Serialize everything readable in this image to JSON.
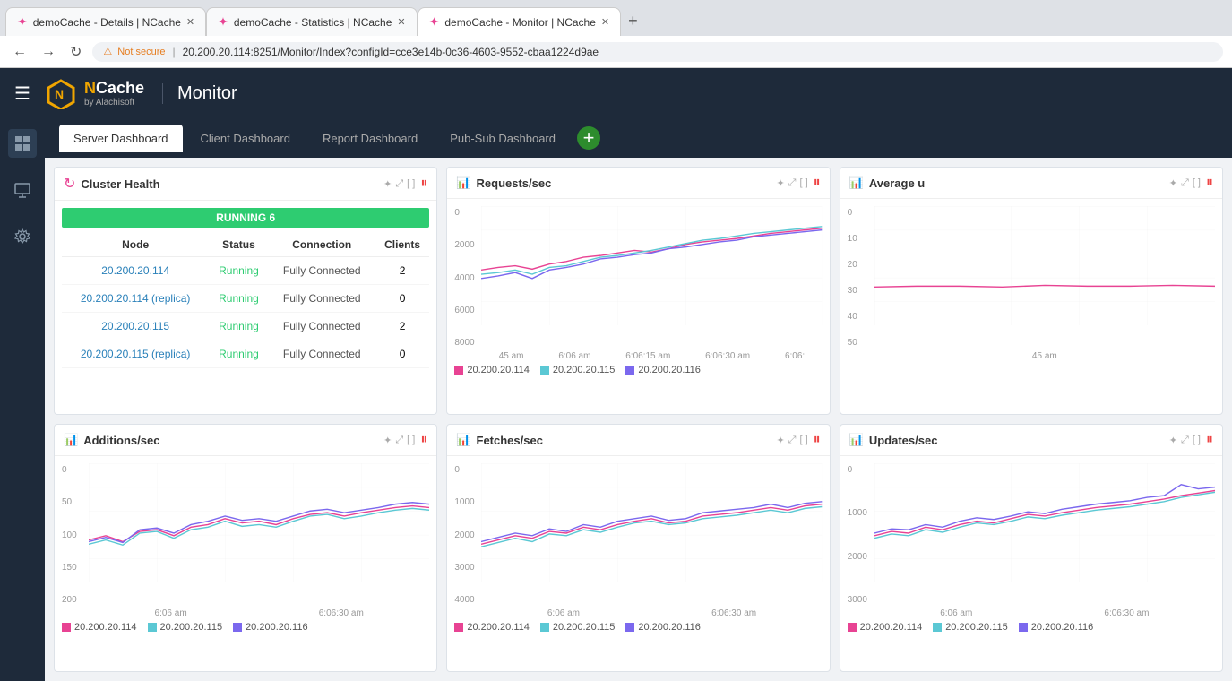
{
  "browser": {
    "tabs": [
      {
        "label": "demoCache - Details | NCache",
        "active": false
      },
      {
        "label": "demoCache - Statistics | NCache",
        "active": false
      },
      {
        "label": "demoCache - Monitor | NCache",
        "active": true
      }
    ],
    "address": "20.200.20.114:8251/Monitor/Index?configId=cce3e14b-0c36-4603-9552-cbaa1224d9ae",
    "security_warning": "Not secure"
  },
  "header": {
    "app_title": "Monitor",
    "logo": "NCache",
    "logo_sub": "by Alachisoft"
  },
  "nav_tabs": [
    {
      "label": "Server Dashboard",
      "active": true
    },
    {
      "label": "Client Dashboard",
      "active": false
    },
    {
      "label": "Report Dashboard",
      "active": false
    },
    {
      "label": "Pub-Sub Dashboard",
      "active": false
    }
  ],
  "cluster_health": {
    "title": "Cluster Health",
    "status": "RUNNING 6",
    "columns": [
      "Node",
      "Status",
      "Connection",
      "Clients"
    ],
    "rows": [
      {
        "node": "20.200.20.114",
        "status": "Running",
        "connection": "Fully Connected",
        "clients": "2"
      },
      {
        "node": "20.200.20.114 (replica)",
        "status": "Running",
        "connection": "Fully Connected",
        "clients": "0"
      },
      {
        "node": "20.200.20.115",
        "status": "Running",
        "connection": "Fully Connected",
        "clients": "2"
      },
      {
        "node": "20.200.20.115 (replica)",
        "status": "Running",
        "connection": "Fully Connected",
        "clients": "0"
      }
    ]
  },
  "chart_requests": {
    "title": "Requests/sec",
    "y_labels": [
      "8000",
      "6000",
      "4000",
      "2000",
      "0"
    ],
    "x_labels": [
      "45 am",
      "6:06 am",
      "6:06:15 am",
      "6:06:30 am",
      "6:06:"
    ],
    "legend": [
      {
        "label": "20.200.20.114",
        "color": "#e84393"
      },
      {
        "label": "20.200.20.115",
        "color": "#5bc8d4"
      },
      {
        "label": "20.200.20.116",
        "color": "#7b68ee"
      }
    ]
  },
  "chart_avg": {
    "title": "Average u",
    "y_labels": [
      "50",
      "40",
      "30",
      "20",
      "10",
      "0"
    ],
    "x_labels": [
      "45 am"
    ]
  },
  "chart_additions": {
    "title": "Additions/sec",
    "y_labels": [
      "200",
      "150",
      "100",
      "50",
      "0"
    ],
    "x_labels": [
      "6:06 am",
      "6:06:30 am"
    ],
    "legend": [
      {
        "label": "20.200.20.114",
        "color": "#e84393"
      },
      {
        "label": "20.200.20.115",
        "color": "#5bc8d4"
      },
      {
        "label": "20.200.20.116",
        "color": "#7b68ee"
      }
    ]
  },
  "chart_fetches": {
    "title": "Fetches/sec",
    "y_labels": [
      "4000",
      "3000",
      "2000",
      "1000",
      "0"
    ],
    "x_labels": [
      "6:06 am",
      "6:06:30 am"
    ],
    "legend": [
      {
        "label": "20.200.20.114",
        "color": "#e84393"
      },
      {
        "label": "20.200.20.115",
        "color": "#5bc8d4"
      },
      {
        "label": "20.200.20.116",
        "color": "#7b68ee"
      }
    ]
  },
  "chart_updates": {
    "title": "Updates/sec",
    "y_labels": [
      "3000",
      "2000",
      "1000",
      "0"
    ],
    "x_labels": [
      "6:06 am",
      "6:06:30 am"
    ],
    "legend": [
      {
        "label": "20.200.20.114",
        "color": "#e84393"
      },
      {
        "label": "20.200.20.115",
        "color": "#5bc8d4"
      },
      {
        "label": "20.200.20.116",
        "color": "#7b68ee"
      }
    ]
  },
  "icons": {
    "pause": "⏸",
    "expand": "⤢",
    "pin": "✦",
    "chart": "📈",
    "refresh": "↻"
  },
  "colors": {
    "pink": "#e84393",
    "teal": "#5bc8d4",
    "purple": "#7b68ee",
    "green": "#2ecc71",
    "header_bg": "#1e2a3a",
    "accent": "#f0a500"
  }
}
